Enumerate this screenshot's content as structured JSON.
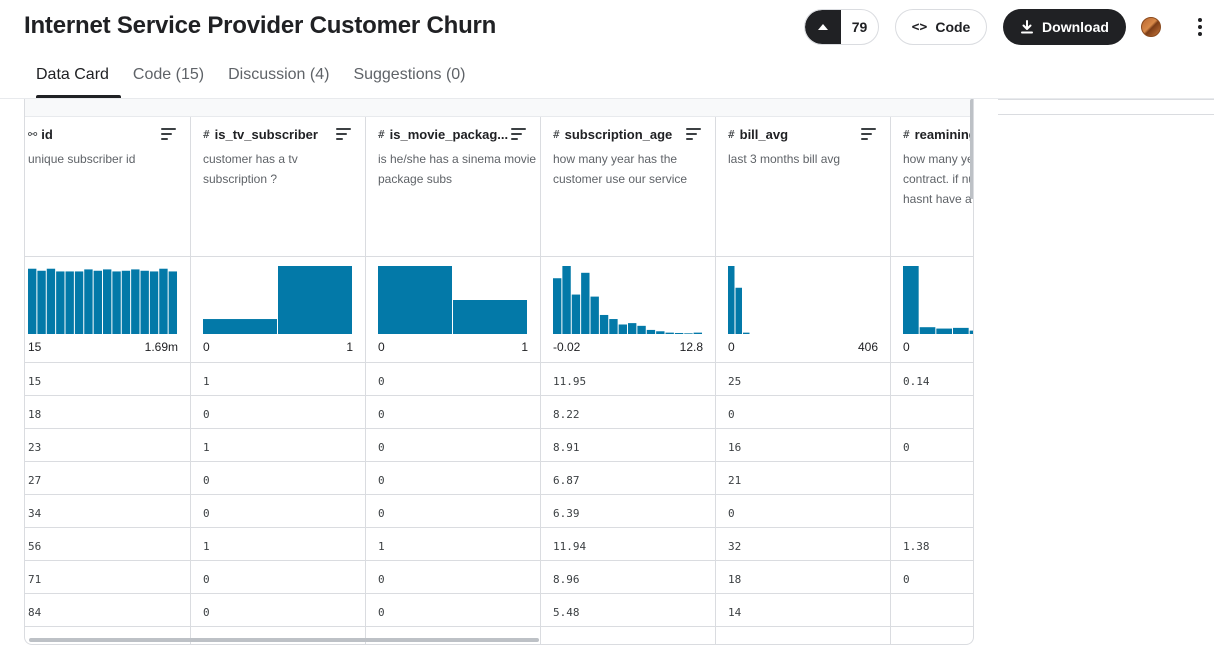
{
  "header": {
    "title": "Internet Service Provider Customer Churn",
    "vote_count": "79",
    "code_label": "Code",
    "download_label": "Download"
  },
  "tabs": [
    {
      "label": "Data Card",
      "active": true
    },
    {
      "label": "Code (15)",
      "active": false
    },
    {
      "label": "Discussion (4)",
      "active": false
    },
    {
      "label": "Suggestions (0)",
      "active": false
    }
  ],
  "colors": {
    "accent": "#0379a8",
    "dark": "#202124",
    "border": "#dadce0"
  },
  "columns": [
    {
      "name": "id",
      "icon": "key-icon",
      "description": "unique subscriber id",
      "range_min": "15",
      "range_max": "1.69m",
      "histogram": [
        0.96,
        0.93,
        0.96,
        0.92,
        0.92,
        0.92,
        0.95,
        0.93,
        0.95,
        0.92,
        0.93,
        0.95,
        0.93,
        0.92,
        0.96,
        0.92
      ],
      "values": [
        "15",
        "18",
        "23",
        "27",
        "34",
        "56",
        "71",
        "84"
      ]
    },
    {
      "name": "is_tv_subscriber",
      "icon": "hash-icon",
      "description": "customer has a tv subscription ?",
      "range_min": "0",
      "range_max": "1",
      "histogram": [
        0.22,
        1.0
      ],
      "values": [
        "1",
        "0",
        "1",
        "0",
        "0",
        "1",
        "0",
        "0"
      ]
    },
    {
      "name": "is_movie_packag...",
      "icon": "hash-icon",
      "description": "is he/she has a sinema movie package subs",
      "range_min": "0",
      "range_max": "1",
      "histogram": [
        1.0,
        0.5
      ],
      "values": [
        "0",
        "0",
        "0",
        "0",
        "0",
        "1",
        "0",
        "0"
      ]
    },
    {
      "name": "subscription_age",
      "icon": "hash-icon",
      "description": "how many year has the customer use our service",
      "range_min": "-0.02",
      "range_max": "12.8",
      "histogram": [
        0.82,
        1.0,
        0.58,
        0.9,
        0.55,
        0.28,
        0.22,
        0.14,
        0.16,
        0.12,
        0.06,
        0.04,
        0.02,
        0.015,
        0.01,
        0.02
      ],
      "values": [
        "11.95",
        "8.22",
        "8.91",
        "6.87",
        "6.39",
        "11.94",
        "8.96",
        "5.48"
      ]
    },
    {
      "name": "bill_avg",
      "icon": "hash-icon",
      "description": "last 3 months bill avg",
      "range_min": "0",
      "range_max": "406",
      "histogram": [
        1.0,
        0.68,
        0.02,
        0.0,
        0.0,
        0.0,
        0.0,
        0.0,
        0.0,
        0.0,
        0.0,
        0.0,
        0.0,
        0.0,
        0.0,
        0.0,
        0.0,
        0.0,
        0.0,
        0.0
      ],
      "values": [
        "25",
        "0",
        "16",
        "21",
        "0",
        "32",
        "18",
        "14"
      ]
    },
    {
      "name": "reamining_contract",
      "icon": "hash-icon",
      "description": "how many year remaining for contract. if null; customer hasnt have a contract. the",
      "range_min": "0",
      "range_max": "",
      "histogram": [
        1.0,
        0.1,
        0.08,
        0.09,
        0.05,
        0.12,
        0.15,
        0.14,
        0.13
      ],
      "values": [
        "0.14",
        "",
        "0",
        "",
        "",
        "1.38",
        "0",
        ""
      ]
    }
  ]
}
